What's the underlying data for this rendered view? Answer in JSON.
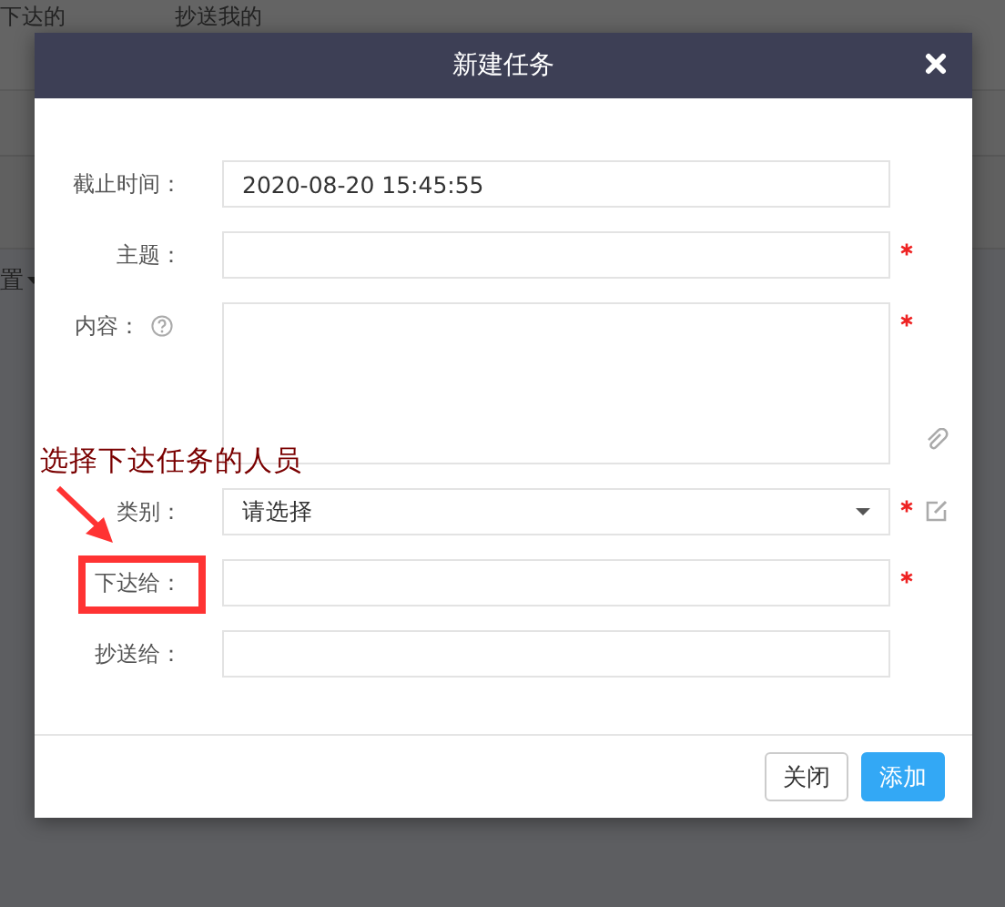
{
  "background": {
    "tabs": [
      {
        "label": "下达的"
      },
      {
        "label": "抄送我的"
      }
    ],
    "menu_fragment": "置"
  },
  "dialog": {
    "title": "新建任务",
    "fields": [
      {
        "kind": "text",
        "label": "截止时间：",
        "value": "2020-08-20 15:45:55",
        "required": false
      },
      {
        "kind": "text",
        "label": "主题：",
        "required": true
      },
      {
        "kind": "textarea",
        "label": "内容：",
        "required": true
      },
      {
        "kind": "select",
        "label": "类别：",
        "value": "请选择",
        "required": true
      },
      {
        "kind": "text",
        "label": "下达给：",
        "required": true
      },
      {
        "kind": "text",
        "label": "抄送给：",
        "required": false
      }
    ],
    "buttons": [
      {
        "label": "关闭",
        "kind": "secondary"
      },
      {
        "label": "添加",
        "kind": "primary"
      }
    ]
  },
  "annotation": {
    "text": "选择下达任务的人员"
  }
}
